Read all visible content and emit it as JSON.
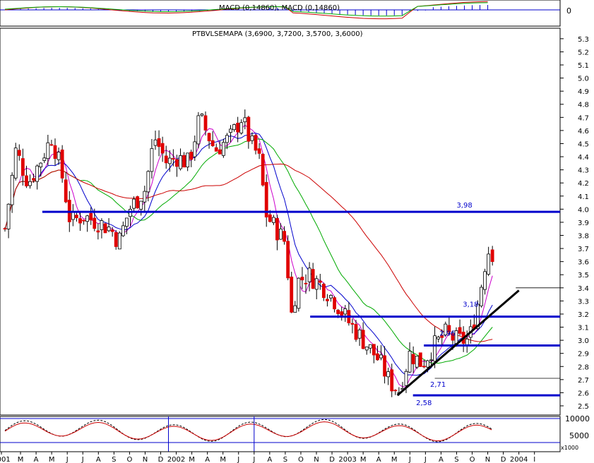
{
  "macd_panel": {
    "label": "MACD (0,14860), MACD (0,14860)",
    "axis_label": "0"
  },
  "main_panel": {
    "label": "PTBVLSEMAPA (3,6900, 3,7200, 3,5700, 3,6000)"
  },
  "volume_panel": {
    "labels": [
      "10000",
      "5000",
      "x1000"
    ]
  },
  "chart_data": {
    "type": "candlestick",
    "instrument": "PTBVLSEMAPA",
    "last_bar": {
      "open": 3.69,
      "high": 3.72,
      "low": 3.57,
      "close": 3.6
    },
    "y_axis": {
      "ylim": [
        2.43,
        5.38
      ],
      "ticks": [
        "2.5",
        "2.6",
        "2.7",
        "2.8",
        "2.9",
        "3.0",
        "3.1",
        "3.2",
        "3.3",
        "3.4",
        "3.5",
        "3.6",
        "3.7",
        "3.8",
        "3.9",
        "4.0",
        "4.1",
        "4.2",
        "4.3",
        "4.4",
        "4.5",
        "4.6",
        "4.7",
        "4.8",
        "4.9",
        "5.0",
        "5.1",
        "5.2",
        "5.3"
      ]
    },
    "x_axis": {
      "ticks": [
        "2001",
        "M",
        "A",
        "M",
        "J",
        "J",
        "A",
        "S",
        "O",
        "N",
        "D",
        "2002",
        "M",
        "A",
        "M",
        "J",
        "J",
        "A",
        "S",
        "O",
        "N",
        "D",
        "2003",
        "M",
        "A",
        "M",
        "J",
        "J",
        "A",
        "S",
        "O",
        "N",
        "D",
        "2004",
        "I"
      ]
    },
    "price_path": [
      {
        "m": 0.0,
        "p": 3.85
      },
      {
        "m": 0.7,
        "p": 4.45
      },
      {
        "m": 1.5,
        "p": 4.2
      },
      {
        "m": 2.2,
        "p": 4.35
      },
      {
        "m": 3.0,
        "p": 4.55
      },
      {
        "m": 3.6,
        "p": 4.3
      },
      {
        "m": 4.2,
        "p": 3.9
      },
      {
        "m": 5.0,
        "p": 3.95
      },
      {
        "m": 6.0,
        "p": 3.9
      },
      {
        "m": 6.8,
        "p": 3.85
      },
      {
        "m": 7.3,
        "p": 3.75
      },
      {
        "m": 8.0,
        "p": 4.0
      },
      {
        "m": 9.0,
        "p": 4.15
      },
      {
        "m": 9.6,
        "p": 4.55
      },
      {
        "m": 10.4,
        "p": 4.35
      },
      {
        "m": 11.0,
        "p": 4.4
      },
      {
        "m": 11.8,
        "p": 4.35
      },
      {
        "m": 12.5,
        "p": 4.7
      },
      {
        "m": 13.5,
        "p": 4.45
      },
      {
        "m": 14.5,
        "p": 4.55
      },
      {
        "m": 15.2,
        "p": 4.7
      },
      {
        "m": 15.8,
        "p": 4.5
      },
      {
        "m": 16.3,
        "p": 4.4
      },
      {
        "m": 16.8,
        "p": 3.95
      },
      {
        "m": 17.4,
        "p": 3.85
      },
      {
        "m": 18.0,
        "p": 3.75
      },
      {
        "m": 18.4,
        "p": 3.2
      },
      {
        "m": 18.8,
        "p": 3.45
      },
      {
        "m": 19.5,
        "p": 3.5
      },
      {
        "m": 20.5,
        "p": 3.4
      },
      {
        "m": 21.2,
        "p": 3.3
      },
      {
        "m": 22.0,
        "p": 3.15
      },
      {
        "m": 23.0,
        "p": 3.0
      },
      {
        "m": 24.0,
        "p": 2.85
      },
      {
        "m": 24.7,
        "p": 2.68
      },
      {
        "m": 25.3,
        "p": 2.62
      },
      {
        "m": 26.0,
        "p": 2.9
      },
      {
        "m": 26.8,
        "p": 2.82
      },
      {
        "m": 27.5,
        "p": 2.95
      },
      {
        "m": 28.3,
        "p": 3.05
      },
      {
        "m": 29.0,
        "p": 3.0
      },
      {
        "m": 29.8,
        "p": 3.0
      },
      {
        "m": 30.4,
        "p": 3.3
      },
      {
        "m": 31.0,
        "p": 3.7
      },
      {
        "m": 31.3,
        "p": 3.6
      }
    ],
    "horizontal_lines": [
      {
        "value": 3.98,
        "label": "3,98"
      },
      {
        "value": 3.18,
        "label": "3,18"
      },
      {
        "value": 2.96,
        "label": "2,96"
      },
      {
        "value": 2.71,
        "label": "2,71"
      },
      {
        "value": 2.58,
        "label": "2,58"
      },
      {
        "value": 3.4,
        "label": ""
      }
    ],
    "trendline": {
      "from": {
        "m": 25.2,
        "p": 2.58
      },
      "to": {
        "m": 33.0,
        "p": 3.38
      }
    },
    "colors": {
      "up": "#ffffff",
      "down": "#e00000",
      "ma_short": "#0000cc",
      "ma_mid": "#00aa00",
      "ma_long": "#cc0000",
      "ma_fast": "#cc00cc",
      "level": "#0000cc",
      "trend": "#000000"
    }
  }
}
